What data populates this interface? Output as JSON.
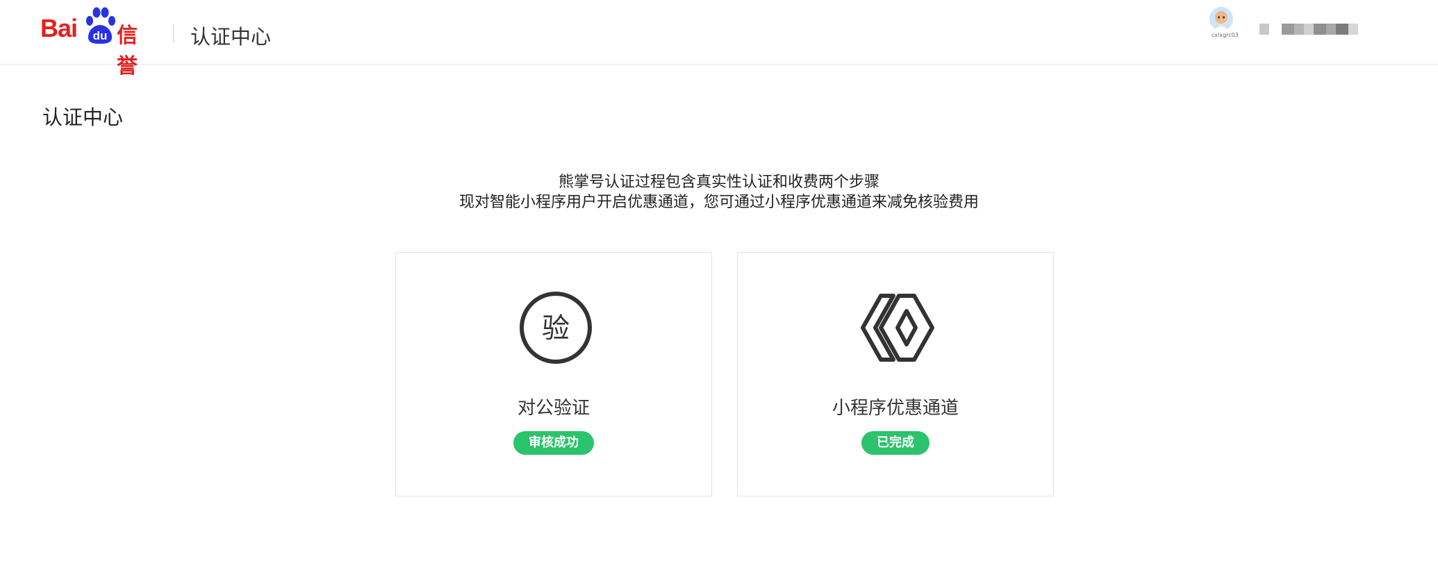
{
  "header": {
    "logo_text": "Bai",
    "logo_paw_text": "du",
    "logo_product": "信誉",
    "title": "认证中心",
    "user": {
      "avatar_caption": "cxlxgrc03"
    }
  },
  "page": {
    "title": "认证中心",
    "intro_line1": "熊掌号认证过程包含真实性认证和收费两个步骤",
    "intro_line2": "现对智能小程序用户开启优惠通道，您可通过小程序优惠通道来减免核验费用"
  },
  "cards": [
    {
      "icon": "verify-seal-icon",
      "icon_text": "验",
      "title": "对公验证",
      "status": "审核成功"
    },
    {
      "icon": "mini-program-icon",
      "title": "小程序优惠通道",
      "status": "已完成"
    }
  ],
  "colors": {
    "brand_red": "#e5201d",
    "brand_blue": "#2932e1",
    "success_green": "#2bc36b"
  }
}
